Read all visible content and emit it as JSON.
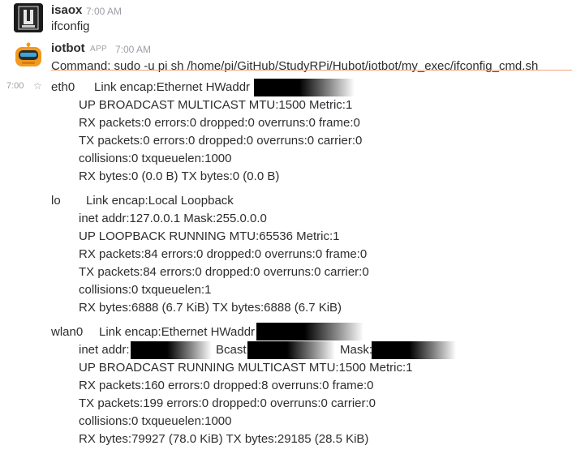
{
  "msg1": {
    "user": "isaox",
    "time": "7:00 AM",
    "text": "ifconfig"
  },
  "msg2": {
    "user": "iotbot",
    "app_badge": "APP",
    "time": "7:00 AM",
    "text": "Command: sudo -u pi sh /home/pi/GitHub/StudyRPi/Hubot/iotbot/my_exec/ifconfig_cmd.sh"
  },
  "output": {
    "time": "7:00",
    "star": "☆",
    "eth0": {
      "name": "eth0",
      "l1": "Link encap:Ethernet  HWaddr",
      "l2": "UP BROADCAST MULTICAST  MTU:1500  Metric:1",
      "l3": "RX packets:0 errors:0 dropped:0 overruns:0 frame:0",
      "l4": "TX packets:0 errors:0 dropped:0 overruns:0 carrier:0",
      "l5": "collisions:0 txqueuelen:1000",
      "l6": "RX bytes:0 (0.0 B)  TX bytes:0 (0.0 B)"
    },
    "lo": {
      "name": "lo",
      "l1": "Link encap:Local Loopback",
      "l2": "inet addr:127.0.0.1  Mask:255.0.0.0",
      "l3": "UP LOOPBACK RUNNING  MTU:65536  Metric:1",
      "l4": "RX packets:84 errors:0 dropped:0 overruns:0 frame:0",
      "l5": "TX packets:84 errors:0 dropped:0 overruns:0 carrier:0",
      "l6": "collisions:0 txqueuelen:1",
      "l7": "RX bytes:6888 (6.7 KiB)  TX bytes:6888 (6.7 KiB)"
    },
    "wlan0": {
      "name": "wlan0",
      "l1": "Link encap:Ethernet  HWaddr",
      "l2a": "inet addr:",
      "l2b": "Bcast:",
      "l2c": "Mask:",
      "l3": "UP BROADCAST RUNNING MULTICAST  MTU:1500  Metric:1",
      "l4": "RX packets:160 errors:0 dropped:8 overruns:0 frame:0",
      "l5": "TX packets:199 errors:0 dropped:0 overruns:0 carrier:0",
      "l6": "collisions:0 txqueuelen:1000",
      "l7": "RX bytes:79927 (78.0 KiB)  TX bytes:29185 (28.5 KiB)"
    }
  }
}
